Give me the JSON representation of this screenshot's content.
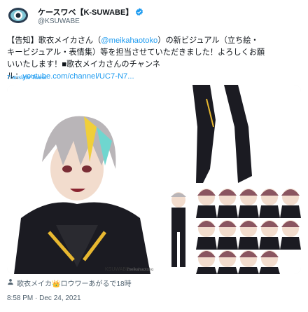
{
  "author": {
    "display_name": "ケースワベ【K-SUWABE】",
    "handle": "@KSUWABE"
  },
  "tweet": {
    "line1": "【告知】歌衣メイカさん（",
    "mention": "@meikahaotoko",
    "line1b": "）の新ビジュアル（立ち絵・",
    "line2": "キービジュアル・表情集）等を担当させていただきました！よろしくお願",
    "line3": "いいたします！■歌衣メイカさんのチャンネ",
    "line4a": "ル：",
    "link": "youtube.com/channel/UC7-N7...",
    "translate": "Translate Tweet"
  },
  "media": {
    "watermark": "KSUWABE",
    "watermark2": "meikahaotoko"
  },
  "media_tag": "歌衣メイカ👑ロウワーあがるで18時",
  "timestamp": "8:58 PM · Dec 24, 2021",
  "colors": {
    "accent": "#1d9bf0",
    "secondary_text": "#536471",
    "primary_text": "#0f1419"
  },
  "icons": [
    "verified-badge-icon",
    "person-tag-icon"
  ]
}
